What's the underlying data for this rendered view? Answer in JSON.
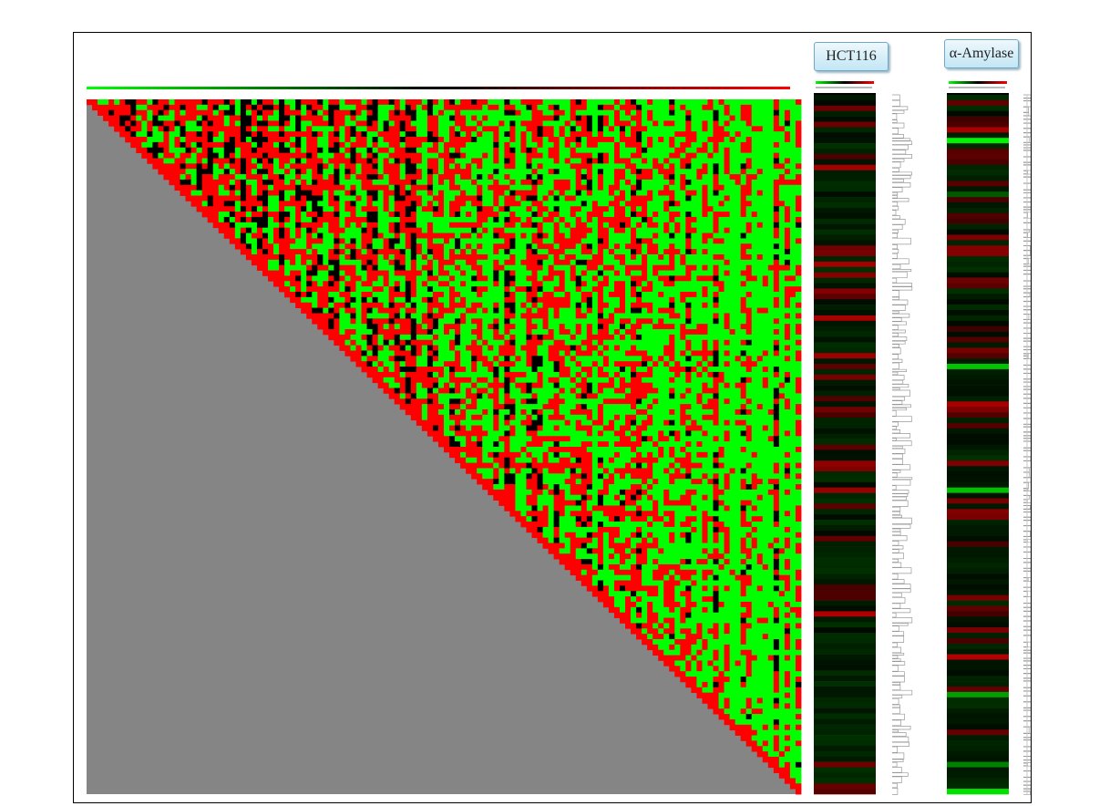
{
  "panel_labels": [
    "HCT116",
    "α-Amylase"
  ],
  "colors": {
    "high": "#ff0000",
    "low": "#00ff00",
    "mid": "#000000",
    "masked": "#858585",
    "dendrogram": "#9a9a9a"
  },
  "chart_data": [
    {
      "type": "heatmap",
      "name_printed": "",
      "description": "Triangular pairwise correlation matrix (upper triangle only)",
      "color_scale": [
        "#00ff00",
        "#000000",
        "#ff0000"
      ],
      "matrix_size": 130,
      "masked_region": "lower-left triangle",
      "seed": 7
    },
    {
      "type": "heatmap",
      "label": "HCT116",
      "color_scale": [
        "#00ff00",
        "#000000",
        "#ff0000"
      ],
      "rows": 130,
      "seed": 19
    },
    {
      "type": "heatmap",
      "label": "α-Amylase",
      "color_scale": [
        "#00ff00",
        "#000000",
        "#ff0000"
      ],
      "rows": 130,
      "seed": 41
    }
  ]
}
